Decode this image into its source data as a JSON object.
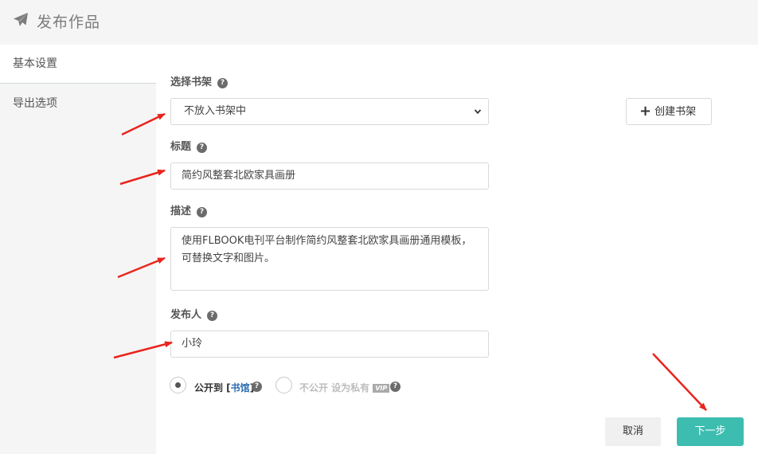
{
  "header": {
    "title": "发布作品",
    "icon": "paper-plane-icon"
  },
  "sidebar": {
    "items": [
      {
        "label": "基本设置",
        "active": true
      },
      {
        "label": "导出选项",
        "active": false
      }
    ]
  },
  "form": {
    "bookshelf": {
      "label": "选择书架",
      "selected": "不放入书架中",
      "create_label": "创建书架"
    },
    "title": {
      "label": "标题",
      "value": "简约风整套北欧家具画册"
    },
    "description": {
      "label": "描述",
      "value": "使用FLBOOK电刊平台制作简约风整套北欧家具画册通用模板，可替换文字和图片。"
    },
    "publisher": {
      "label": "发布人",
      "value": "小玲"
    },
    "visibility": {
      "public_label_prefix": "公开到 [",
      "public_label_link": "书馆",
      "public_label_suffix": "]",
      "private_label": "不公开 设为私有",
      "vip_badge": "VIP",
      "selected": "public"
    }
  },
  "actions": {
    "cancel_label": "取消",
    "next_label": "下一步"
  },
  "colors": {
    "accent": "#3dbdb0",
    "link": "#2b6cb0",
    "arrow": "#e8251e"
  }
}
